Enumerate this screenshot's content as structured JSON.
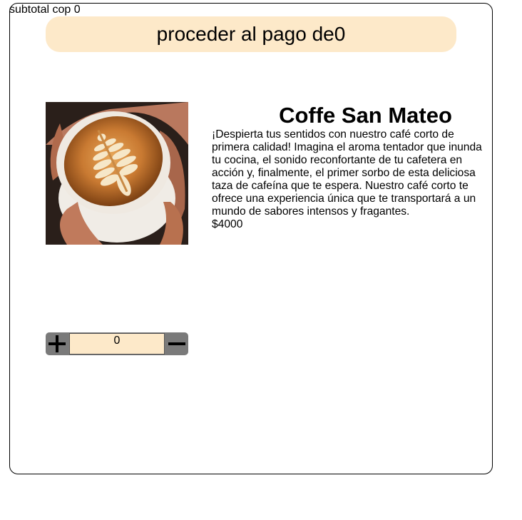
{
  "header": {
    "subtotal_text": "subtotal cop 0",
    "checkout_label": "proceder al pago de0"
  },
  "product": {
    "image_alt": "Coffe San Mateo",
    "title": "Coffe San Mateo",
    "description": "¡Despierta tus sentidos con nuestro café corto de primera calidad! Imagina el aroma tentador que inunda tu cocina, el sonido reconfortante de tu cafetera en acción y, finalmente, el primer sorbo de esta deliciosa taza de cafeína que te espera. Nuestro café corto te ofrece una experiencia única que te transportará a un mundo de sabores intensos y fragantes.",
    "price": "$4000"
  },
  "quantity": {
    "plus_symbol": "+",
    "minus_symbol": "−",
    "value": "0"
  },
  "colors": {
    "accent": "#fde9c9",
    "stepper_bg": "#7a7a7a"
  }
}
